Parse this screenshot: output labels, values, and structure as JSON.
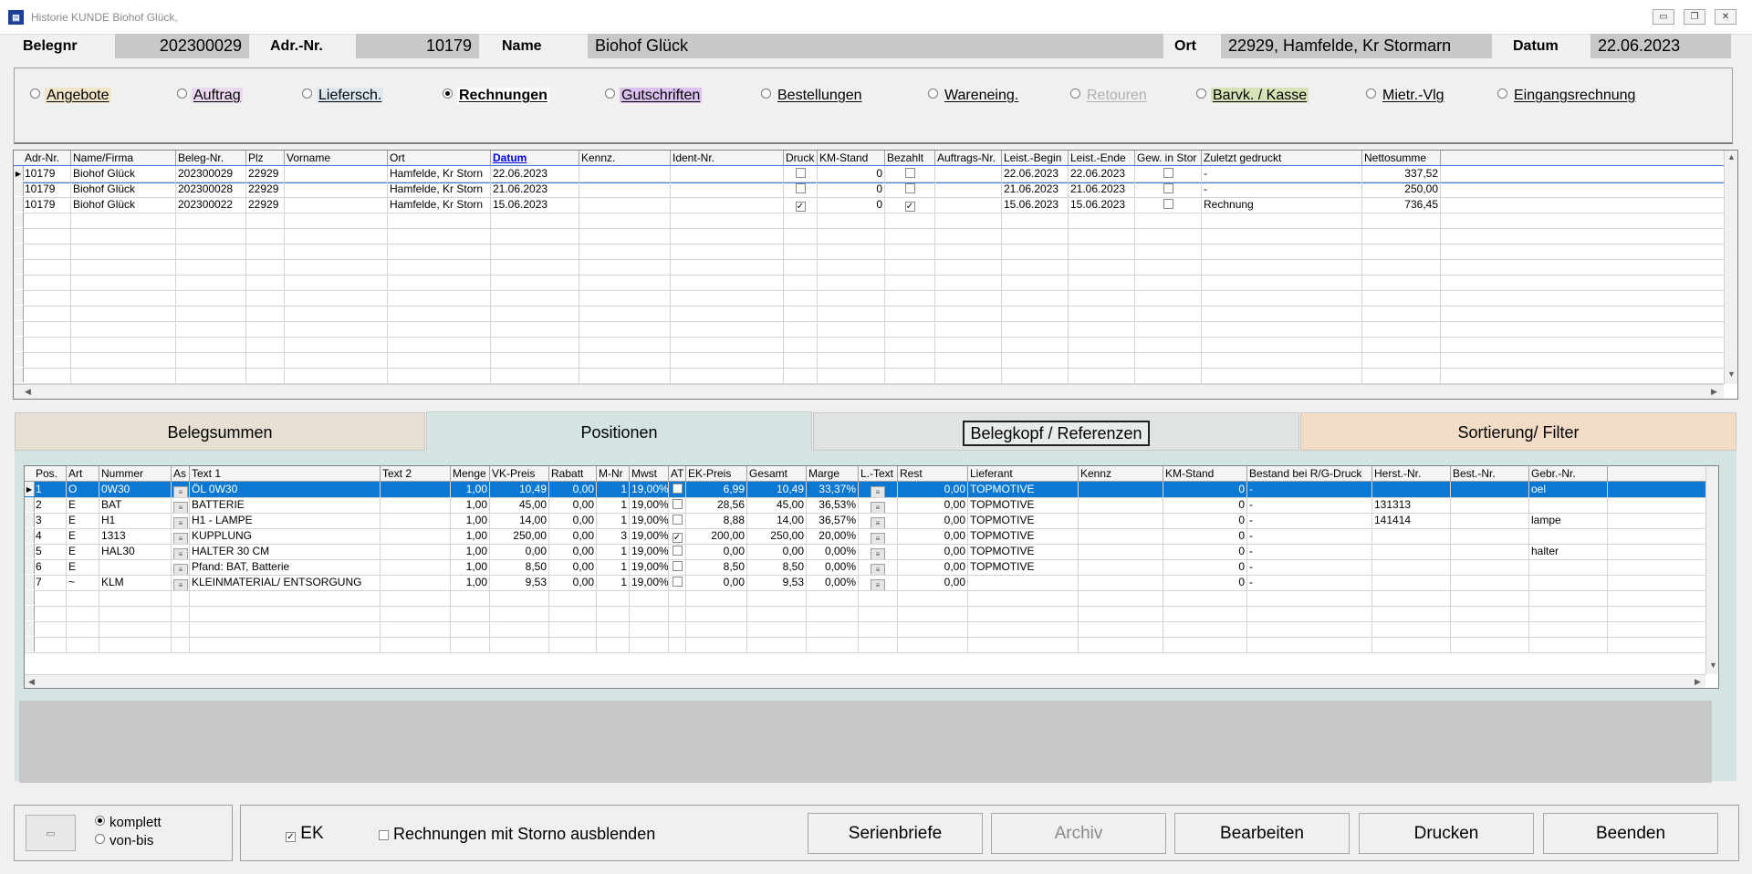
{
  "window": {
    "title": "Historie KUNDE Biohof Glück,"
  },
  "header": {
    "belegnr_label": "Belegnr",
    "belegnr_value": "202300029",
    "adrnr_label": "Adr.-Nr.",
    "adrnr_value": "10179",
    "name_label": "Name",
    "name_value": "Biohof Glück",
    "ort_label": "Ort",
    "ort_value": "22929, Hamfelde, Kr Stormarn",
    "datum_label": "Datum",
    "datum_value": "22.06.2023"
  },
  "doc_types": [
    {
      "label": "Angebote",
      "selected": false,
      "color": "#f2e4c8"
    },
    {
      "label": "Auftrag",
      "selected": false,
      "color": "#ead8f0"
    },
    {
      "label": "Liefersch.",
      "selected": false,
      "color": "#dde8f0"
    },
    {
      "label": "Rechnungen",
      "selected": true,
      "color": "#ffffff"
    },
    {
      "label": "Gutschriften",
      "selected": false,
      "color": "#dcc0f0"
    },
    {
      "label": "Bestellungen",
      "selected": false,
      "color": "#f0f0f0"
    },
    {
      "label": "Wareneing.",
      "selected": false,
      "color": "#f0f0f0"
    },
    {
      "label": "Retouren",
      "selected": false,
      "color": "#f0f0f0"
    },
    {
      "label": "Barvk. / Kasse",
      "selected": false,
      "color": "#d8e2b8"
    },
    {
      "label": "Mietr.-Vlg",
      "selected": false,
      "color": "#f0f0f0"
    },
    {
      "label": "Eingangsrechnung",
      "selected": false,
      "color": "#f0f0f0"
    }
  ],
  "belege": {
    "columns": [
      "Adr-Nr.",
      "Name/Firma",
      "Beleg-Nr.",
      "Plz",
      "Vorname",
      "Ort",
      "Datum",
      "Kennz.",
      "Ident-Nr.",
      "Druck",
      "KM-Stand",
      "Bezahlt",
      "Auftrags-Nr.",
      "Leist.-Begin",
      "Leist.-Ende",
      "Gew. in Stor",
      "Zuletzt gedruckt",
      "Nettosumme"
    ],
    "rows": [
      [
        "10179",
        "Biohof Glück",
        "202300029",
        "22929",
        "",
        "Hamfelde, Kr Storn",
        "22.06.2023",
        "",
        "",
        "",
        "0",
        "",
        "",
        "22.06.2023",
        "22.06.2023",
        "",
        "-",
        "337,52"
      ],
      [
        "10179",
        "Biohof Glück",
        "202300028",
        "22929",
        "",
        "Hamfelde, Kr Storn",
        "21.06.2023",
        "",
        "",
        "",
        "0",
        "",
        "",
        "21.06.2023",
        "21.06.2023",
        "",
        "-",
        "250,00"
      ],
      [
        "10179",
        "Biohof Glück",
        "202300022",
        "22929",
        "",
        "Hamfelde, Kr Storn",
        "15.06.2023",
        "",
        "",
        "✓",
        "0",
        "✓",
        "",
        "15.06.2023",
        "15.06.2023",
        "",
        "Rechnung",
        "736,45"
      ]
    ]
  },
  "tabs": [
    {
      "label": "Belegsummen"
    },
    {
      "label": "Positionen"
    },
    {
      "label": "Belegkopf / Referenzen"
    },
    {
      "label": "Sortierung/ Filter"
    }
  ],
  "positionen": {
    "columns": [
      "Pos.",
      "Art",
      "Nummer",
      "As",
      "Text 1",
      "Text 2",
      "Menge",
      "VK-Preis",
      "Rabatt",
      "M-Nr",
      "Mwst",
      "AT",
      "EK-Preis",
      "Gesamt",
      "Marge",
      "L.-Text",
      "Rest",
      "Lieferant",
      "Kennz",
      "KM-Stand",
      "Bestand bei R/G-Druck",
      "Herst.-Nr.",
      "Best.-Nr.",
      "Gebr.-Nr."
    ],
    "rows": [
      [
        "1",
        "O",
        "0W30",
        "",
        "ÖL 0W30",
        "",
        "1,00",
        "10,49",
        "0,00",
        "1",
        "19,00%",
        "",
        "6,99",
        "10,49",
        "33,37%",
        "",
        "0,00",
        "TOPMOTIVE",
        "",
        "0",
        "-",
        "",
        "",
        "oel"
      ],
      [
        "2",
        "E",
        "BAT",
        "",
        "BATTERIE",
        "",
        "1,00",
        "45,00",
        "0,00",
        "1",
        "19,00%",
        "",
        "28,56",
        "45,00",
        "36,53%",
        "",
        "0,00",
        "TOPMOTIVE",
        "",
        "0",
        "-",
        "131313",
        "",
        ""
      ],
      [
        "3",
        "E",
        "H1",
        "",
        "H1 - LAMPE",
        "",
        "1,00",
        "14,00",
        "0,00",
        "1",
        "19,00%",
        "",
        "8,88",
        "14,00",
        "36,57%",
        "",
        "0,00",
        "TOPMOTIVE",
        "",
        "0",
        "-",
        "141414",
        "",
        "lampe"
      ],
      [
        "4",
        "E",
        "1313",
        "",
        "KUPPLUNG",
        "",
        "1,00",
        "250,00",
        "0,00",
        "3",
        "19,00%",
        "✓",
        "200,00",
        "250,00",
        "20,00%",
        "",
        "0,00",
        "TOPMOTIVE",
        "",
        "0",
        "-",
        "",
        "",
        ""
      ],
      [
        "5",
        "E",
        "HAL30",
        "",
        "HALTER 30 CM",
        "",
        "1,00",
        "0,00",
        "0,00",
        "1",
        "19,00%",
        "",
        "0,00",
        "0,00",
        "0,00%",
        "",
        "0,00",
        "TOPMOTIVE",
        "",
        "0",
        "-",
        "",
        "",
        "halter"
      ],
      [
        "6",
        "E",
        "",
        "",
        "Pfand: BAT, Batterie",
        "",
        "1,00",
        "8,50",
        "0,00",
        "1",
        "19,00%",
        "",
        "8,50",
        "8,50",
        "0,00%",
        "",
        "0,00",
        "TOPMOTIVE",
        "",
        "0",
        "-",
        "",
        "",
        ""
      ],
      [
        "7",
        "~",
        "KLM",
        "",
        "KLEINMATERIAL/ ENTSORGUNG",
        "",
        "1,00",
        "9,53",
        "0,00",
        "1",
        "19,00%",
        "",
        "0,00",
        "9,53",
        "0,00%",
        "",
        "0,00",
        "",
        "",
        "0",
        "-",
        "",
        "",
        ""
      ]
    ]
  },
  "bottom": {
    "opt_komplett": "komplett",
    "opt_vonbis": "von-bis",
    "ek_label": "EK",
    "storno_label": "Rechnungen mit Storno ausblenden",
    "btn_serienbriefe": "Serienbriefe",
    "btn_archiv": "Archiv",
    "btn_bearbeiten": "Bearbeiten",
    "btn_drucken": "Drucken",
    "btn_beenden": "Beenden"
  }
}
